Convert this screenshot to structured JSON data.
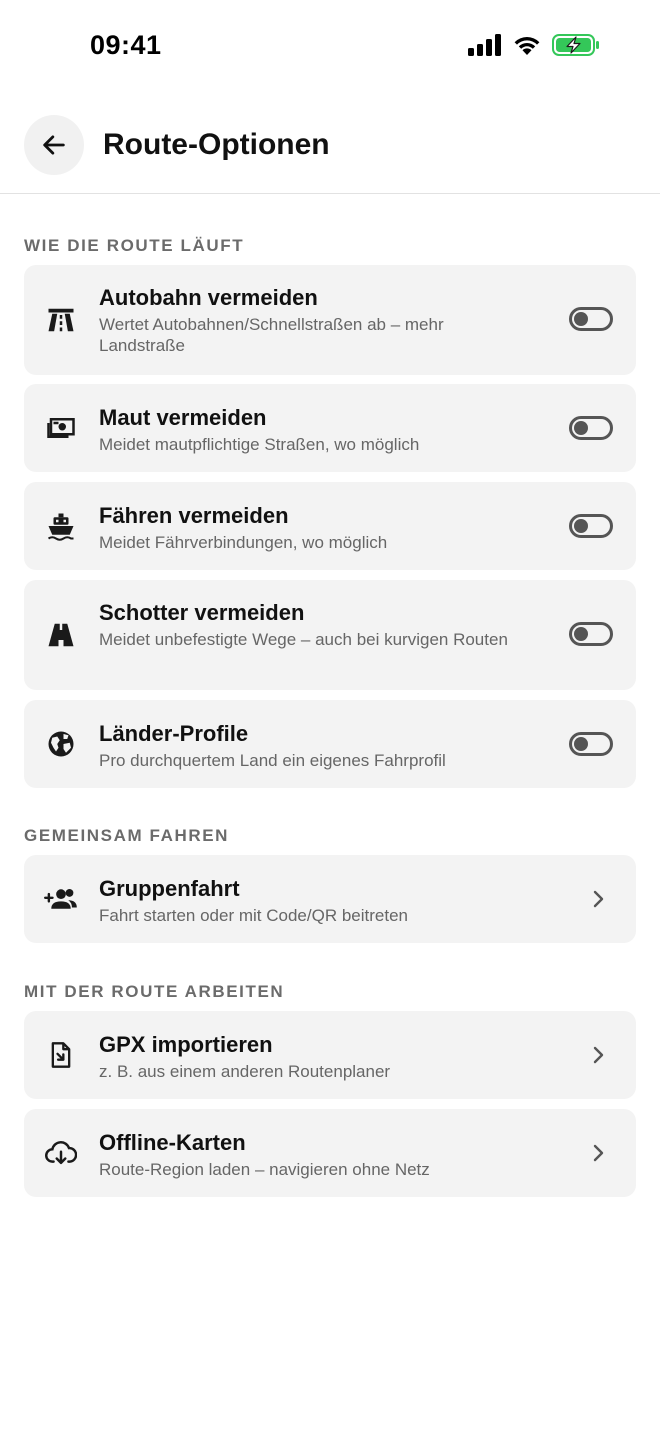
{
  "status": {
    "time": "09:41",
    "icons": [
      "signal-icon",
      "wifi-icon",
      "battery-charging-icon"
    ],
    "battery_color": "#34c759"
  },
  "header": {
    "back_icon": "arrow-left-icon",
    "title": "Route-Optionen"
  },
  "sections": {
    "route": {
      "title": "WIE DIE ROUTE LÄUFT",
      "items": [
        {
          "icon": "highway-icon",
          "title": "Autobahn vermeiden",
          "subtitle": "Wertet Autobahnen/Schnellstraßen ab – mehr Landstraße",
          "enabled": false
        },
        {
          "icon": "toll-icon",
          "title": "Maut vermeiden",
          "subtitle": "Meidet mautpflichtige Straßen, wo möglich",
          "enabled": false
        },
        {
          "icon": "ferry-icon",
          "title": "Fähren vermeiden",
          "subtitle": "Meidet Fährverbindungen, wo möglich",
          "enabled": false
        },
        {
          "icon": "gravel-road-icon",
          "title": "Schotter vermeiden",
          "subtitle": "Meidet unbefestigte Wege – auch bei kurvigen Routen",
          "enabled": false
        },
        {
          "icon": "globe-icon",
          "title": "Länder-Profile",
          "subtitle": "Pro durchquertem Land ein eigenes Fahrprofil",
          "enabled": false
        }
      ]
    },
    "together": {
      "title": "GEMEINSAM FAHREN",
      "items": [
        {
          "icon": "group-add-icon",
          "title": "Gruppenfahrt",
          "subtitle": "Fahrt starten oder mit Code/QR beitreten"
        }
      ]
    },
    "work": {
      "title": "MIT DER ROUTE ARBEITEN",
      "items": [
        {
          "icon": "file-import-icon",
          "title": "GPX importieren",
          "subtitle": "z. B. aus einem anderen Routenplaner"
        },
        {
          "icon": "cloud-download-icon",
          "title": "Offline-Karten",
          "subtitle": "Route-Region laden – navigieren ohne Netz"
        }
      ]
    }
  }
}
